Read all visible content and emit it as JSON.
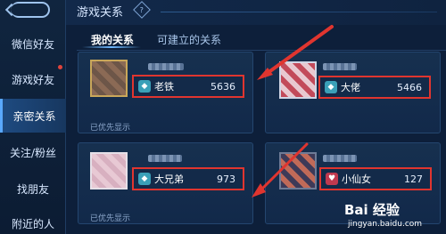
{
  "sidebar": {
    "items": [
      {
        "label": "微信好友"
      },
      {
        "label": "游戏好友"
      },
      {
        "label": "亲密关系"
      },
      {
        "label": "关注/粉丝"
      },
      {
        "label": "找朋友"
      },
      {
        "label": "附近的人"
      }
    ],
    "active_index": 2
  },
  "header": {
    "title": "游戏关系",
    "help_symbol": "?"
  },
  "tabs": [
    {
      "label": "我的关系",
      "active": true
    },
    {
      "label": "可建立的关系",
      "active": false
    }
  ],
  "cards": [
    {
      "relation": "老铁",
      "value": "5636",
      "priority": "已优先显示",
      "icon": "diamond-badge-icon",
      "icon_color": "#3aa0b8"
    },
    {
      "relation": "大佬",
      "value": "5466",
      "priority": "",
      "icon": "diamond-badge-icon",
      "icon_color": "#3aa0b8"
    },
    {
      "relation": "大兄弟",
      "value": "973",
      "priority": "已优先显示",
      "icon": "diamond-badge-icon",
      "icon_color": "#3aa0b8"
    },
    {
      "relation": "小仙女",
      "value": "127",
      "priority": "",
      "icon": "bunny-badge-icon",
      "icon_color": "#c0394f"
    }
  ],
  "watermark": {
    "logo": "Bai 经验",
    "url": "jingyan.baidu.com"
  },
  "colors": {
    "highlight_border": "#e0352f",
    "arrow": "#e0352f",
    "background": "#0d1f3a"
  }
}
